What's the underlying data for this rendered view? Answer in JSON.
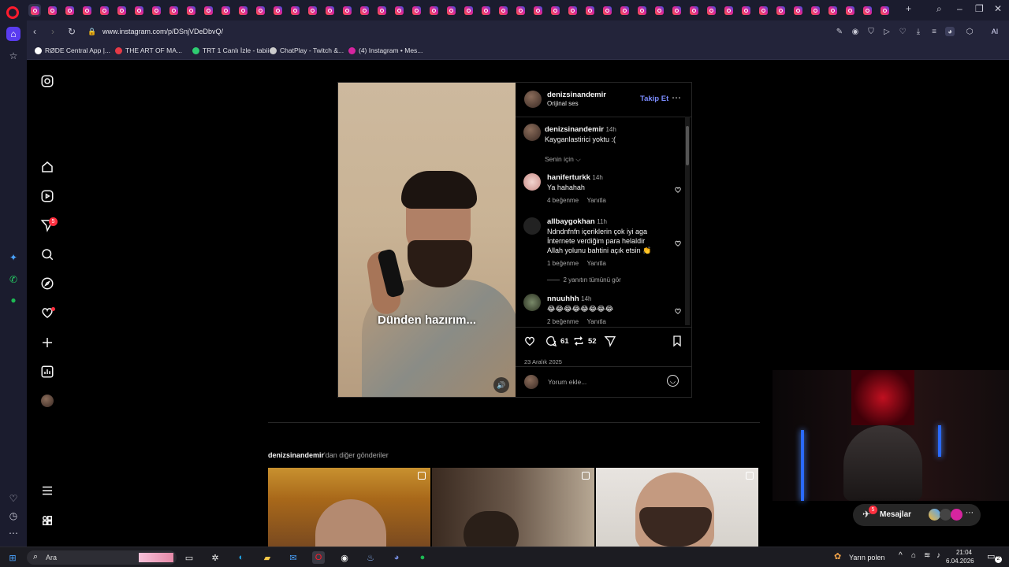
{
  "browser": {
    "url": "www.instagram.com/p/DSnjVDeDbvQ/",
    "tab_count_icons": 50,
    "ai_label": "AI"
  },
  "bookmarks": [
    {
      "label": "RØDE Central App |...",
      "color": "#ffffff"
    },
    {
      "label": "THE ART OF MA...",
      "color": "#e63946"
    },
    {
      "label": "TRT 1 Canlı İzle - tabii",
      "color": "#2ecc71"
    },
    {
      "label": "ChatPlay - Twitch &...",
      "color": "#cccccc"
    },
    {
      "label": "(4) Instagram • Mes...",
      "color": "#d6249f"
    }
  ],
  "ig_nav": {
    "notification_count": "5"
  },
  "post": {
    "author": "denizsinandemir",
    "audio": "Orijinal ses",
    "follow_label": "Takip Et",
    "subtitle": "Dünden hazırım...",
    "caption": {
      "user": "denizsinandemir",
      "time": "14h",
      "text": "Kayganlastirici yoktu :("
    },
    "sort_label": "Senin için",
    "comments": [
      {
        "user": "haniferturkk",
        "time": "14h",
        "text": "Ya hahahah",
        "likes": "4 beğenme",
        "reply": "Yanıtla"
      },
      {
        "user": "allbaygokhan",
        "time": "11h",
        "text": "Ndndnfnfn içeriklerin çok iyi aga İnternete verdiğim para helaldir Allah yolunu bahtini açık etsin 👏",
        "likes": "1 beğenme",
        "reply": "Yanıtla",
        "view_replies": "2 yanıtın tümünü gör"
      },
      {
        "user": "nnuuhhh",
        "time": "14h",
        "text": "😂😂😂😂😂😂😂😂",
        "likes": "2 beğenme",
        "reply": "Yanıtla"
      }
    ],
    "comment_count": "61",
    "repost_count": "52",
    "date": "23 Aralık 2025",
    "comment_placeholder": "Yorum ekle..."
  },
  "more_posts": {
    "user": "denizsinandemir",
    "suffix": "'dan diğer gönderiler"
  },
  "messages": {
    "label": "Mesajlar",
    "badge": "5"
  },
  "taskbar": {
    "search_label": "Ara",
    "weather": "Yarın polen",
    "time": "21:04",
    "date": "6.04.2026",
    "notif": "2"
  }
}
